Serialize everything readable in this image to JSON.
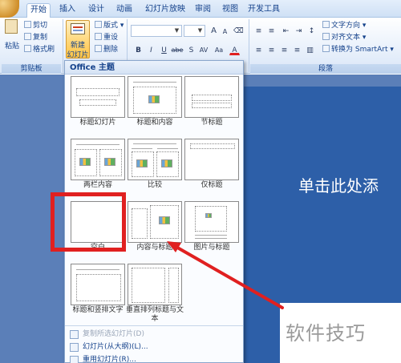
{
  "tabs": {
    "home": "开始",
    "insert": "插入",
    "design": "设计",
    "animations": "动画",
    "slideshow": "幻灯片放映",
    "review": "审阅",
    "view": "视图",
    "developer": "开发工具"
  },
  "ribbon": {
    "clipboard": {
      "paste": "粘贴",
      "cut": "剪切",
      "copy": "复制",
      "format_painter": "格式刷",
      "group_label": "剪贴板"
    },
    "slides": {
      "new_slide_line1": "新建",
      "new_slide_line2": "幻灯片",
      "layout": "版式",
      "reset": "重设",
      "delete": "删除"
    },
    "font": {
      "grow": "A",
      "shrink": "A",
      "bold": "B",
      "italic": "I",
      "underline": "U",
      "strike": "abe",
      "shadow": "S",
      "spacing": "AV",
      "case": "Aa",
      "color": "A"
    },
    "paragraph": {
      "text_direction": "文字方向",
      "align_text": "对齐文本",
      "smartart": "转换为 SmartArt",
      "group_label": "段落"
    }
  },
  "gallery": {
    "header": "Office 主题",
    "layouts": [
      {
        "label": "标题幻灯片"
      },
      {
        "label": "标题和内容"
      },
      {
        "label": "节标题"
      },
      {
        "label": "两栏内容"
      },
      {
        "label": "比较"
      },
      {
        "label": "仅标题"
      },
      {
        "label": "空白"
      },
      {
        "label": "内容与标题"
      },
      {
        "label": "图片与标题"
      },
      {
        "label": "标题和竖排文字"
      },
      {
        "label": "垂直排列标题与文本"
      }
    ],
    "menu": {
      "duplicate": "复制所选幻灯片(D)",
      "from_outline": "幻灯片(从大纲)(L)...",
      "reuse": "重用幻灯片(R)..."
    }
  },
  "slide": {
    "title_placeholder": "单击此处添"
  },
  "watermark": "软件技巧",
  "colors": {
    "highlight": "#e02020",
    "arrow": "#e02020"
  }
}
